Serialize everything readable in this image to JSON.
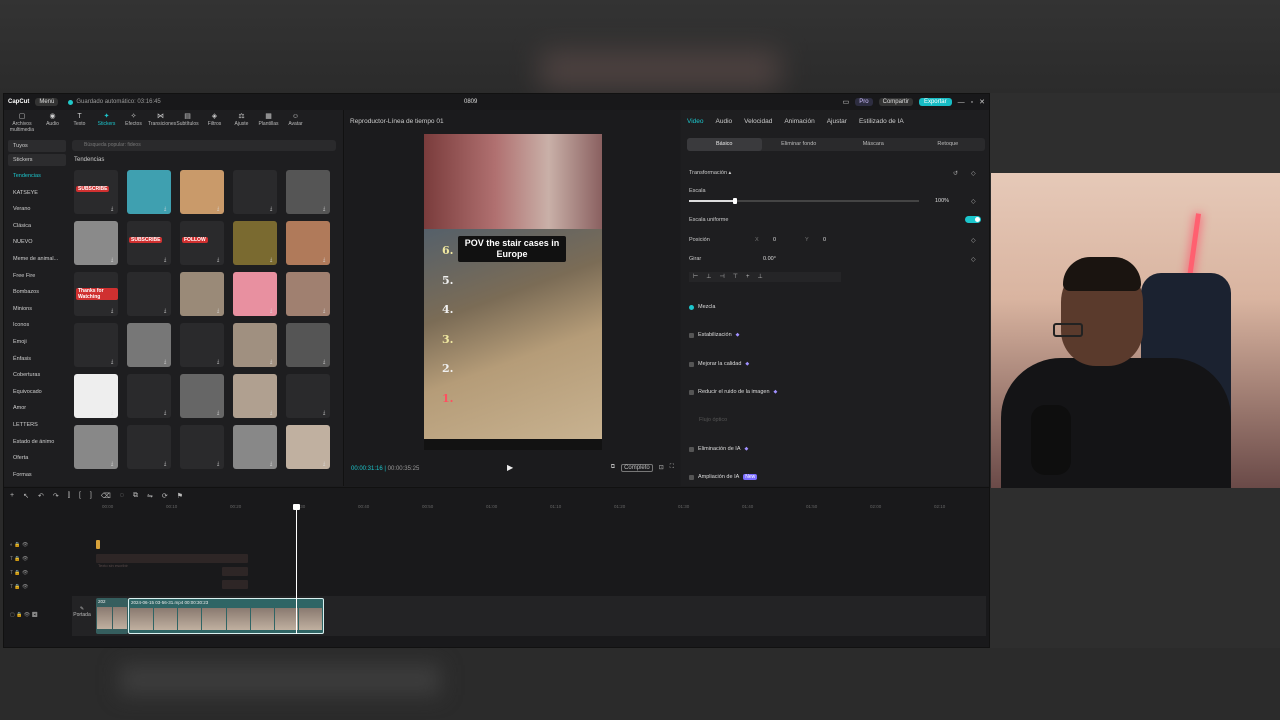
{
  "app": {
    "logo": "CapCut",
    "menu_label": "Menú",
    "autosave": "Guardado automático: 03:16:45",
    "project_title": "0809",
    "pro_label": "Pro",
    "share_label": "Compartir",
    "export_label": "Exportar"
  },
  "left": {
    "tools": [
      {
        "icon": "▢",
        "label": "Archivos multimedia"
      },
      {
        "icon": "◉",
        "label": "Audio"
      },
      {
        "icon": "T",
        "label": "Texto"
      },
      {
        "icon": "✦",
        "label": "Stickers"
      },
      {
        "icon": "✧",
        "label": "Efectos"
      },
      {
        "icon": "⋈",
        "label": "Transiciones"
      },
      {
        "icon": "▤",
        "label": "Subtítulos"
      },
      {
        "icon": "◈",
        "label": "Filtros"
      },
      {
        "icon": "⚖",
        "label": "Ajuste"
      },
      {
        "icon": "▦",
        "label": "Plantillas"
      },
      {
        "icon": "☺",
        "label": "Avatar"
      }
    ],
    "categories": [
      "Tuyos",
      "Stickers",
      "Tendencias",
      "KATSEYE",
      "Verano",
      "Clásica",
      "NUEVO",
      "Meme de animal...",
      "Free Fire",
      "Bombazos",
      "Minions",
      "Iconos",
      "Emoji",
      "Énfasis",
      "Coberturas",
      "Equivocado",
      "Amor",
      "LETTERS",
      "Estado de ánimo",
      "Oferta",
      "Formas"
    ],
    "search_placeholder": "Búsqueda popular: fideos",
    "section_title": "Tendencias",
    "stickers": [
      {
        "text": "SUBSCRIBE",
        "color": "#2a2a2c"
      },
      {
        "text": "",
        "color": "#3fa0b0"
      },
      {
        "text": "",
        "color": "#c99a6a"
      },
      {
        "text": "",
        "color": "#2a2a2c"
      },
      {
        "text": "",
        "color": "#555555"
      },
      {
        "text": "",
        "color": "#8a8a8a"
      },
      {
        "text": "SUBSCRIBE",
        "color": "#2a2a2c"
      },
      {
        "text": "FOLLOW",
        "color": "#2a2a2c"
      },
      {
        "text": "",
        "color": "#7a6a30"
      },
      {
        "text": "",
        "color": "#b07a5a"
      },
      {
        "text": "Thanks for Watching",
        "color": "#2a2a2c"
      },
      {
        "text": "",
        "color": "#2a2a2c"
      },
      {
        "text": "",
        "color": "#9a8a78"
      },
      {
        "text": "",
        "color": "#e890a0"
      },
      {
        "text": "",
        "color": "#a08070"
      },
      {
        "text": "",
        "color": "#2a2a2c"
      },
      {
        "text": "",
        "color": "#777777"
      },
      {
        "text": "",
        "color": "#2a2a2c"
      },
      {
        "text": "",
        "color": "#a09080"
      },
      {
        "text": "",
        "color": "#555555"
      },
      {
        "text": "",
        "color": "#eeeeee"
      },
      {
        "text": "",
        "color": "#2a2a2c"
      },
      {
        "text": "",
        "color": "#666666"
      },
      {
        "text": "",
        "color": "#b0a090"
      },
      {
        "text": "",
        "color": "#2a2a2c"
      },
      {
        "text": "",
        "color": "#888888"
      },
      {
        "text": "",
        "color": "#2a2a2c"
      },
      {
        "text": "",
        "color": "#2a2a2c"
      },
      {
        "text": "",
        "color": "#888888"
      },
      {
        "text": "",
        "color": "#c0b0a0"
      }
    ]
  },
  "player": {
    "header": "Reproductor-Línea de tiempo 01",
    "caption": "POV the stair cases in Europe",
    "numbers": [
      {
        "label": "6.",
        "color": "#f0e8a0"
      },
      {
        "label": "5.",
        "color": "#f0f0f0"
      },
      {
        "label": "4.",
        "color": "#f0f0f0"
      },
      {
        "label": "3.",
        "color": "#f0e8a0"
      },
      {
        "label": "2.",
        "color": "#f0f0f0"
      },
      {
        "label": "1.",
        "color": "#ff5060"
      }
    ],
    "current_time": "00:00:31:16",
    "total_time": "00:00:35:25",
    "complete_label": "Completo"
  },
  "right": {
    "tabs": [
      "Video",
      "Audio",
      "Velocidad",
      "Animación",
      "Ajustar",
      "Estilizado de IA"
    ],
    "subtabs": [
      "Básico",
      "Eliminar fondo",
      "Máscara",
      "Retoque"
    ],
    "transform_label": "Transformación",
    "scale_label": "Escala",
    "scale_value": "100%",
    "uniform_label": "Escala uniforme",
    "position_label": "Posición",
    "pos_x": "0",
    "pos_y": "0",
    "rotate_label": "Girar",
    "rotate_value": "0.00°",
    "x_label": "X",
    "y_label": "Y",
    "mix_label": "Mezcla",
    "stabilize_label": "Estabilización",
    "improve_label": "Mejorar la calidad",
    "noise_label": "Reducir el ruido de la imagen",
    "flujo_label": "Flujo óptico",
    "ai_remove_label": "Eliminación de IA",
    "ai_expand_label": "Ampliación de IA",
    "new_badge": "New"
  },
  "timeline": {
    "ruler": [
      "00:00",
      "00:10",
      "00:20",
      "00:30",
      "00:40",
      "00:50",
      "01:00",
      "01:10",
      "01:20",
      "01:30",
      "01:40",
      "01:50",
      "02:00",
      "02:10"
    ],
    "clip1_label": "202",
    "clip2_label": "2024-06-15 03-56-31.mp4   00:00:30:23",
    "cover_label": "Portada",
    "ghost_label": "Texto sin escribir"
  }
}
